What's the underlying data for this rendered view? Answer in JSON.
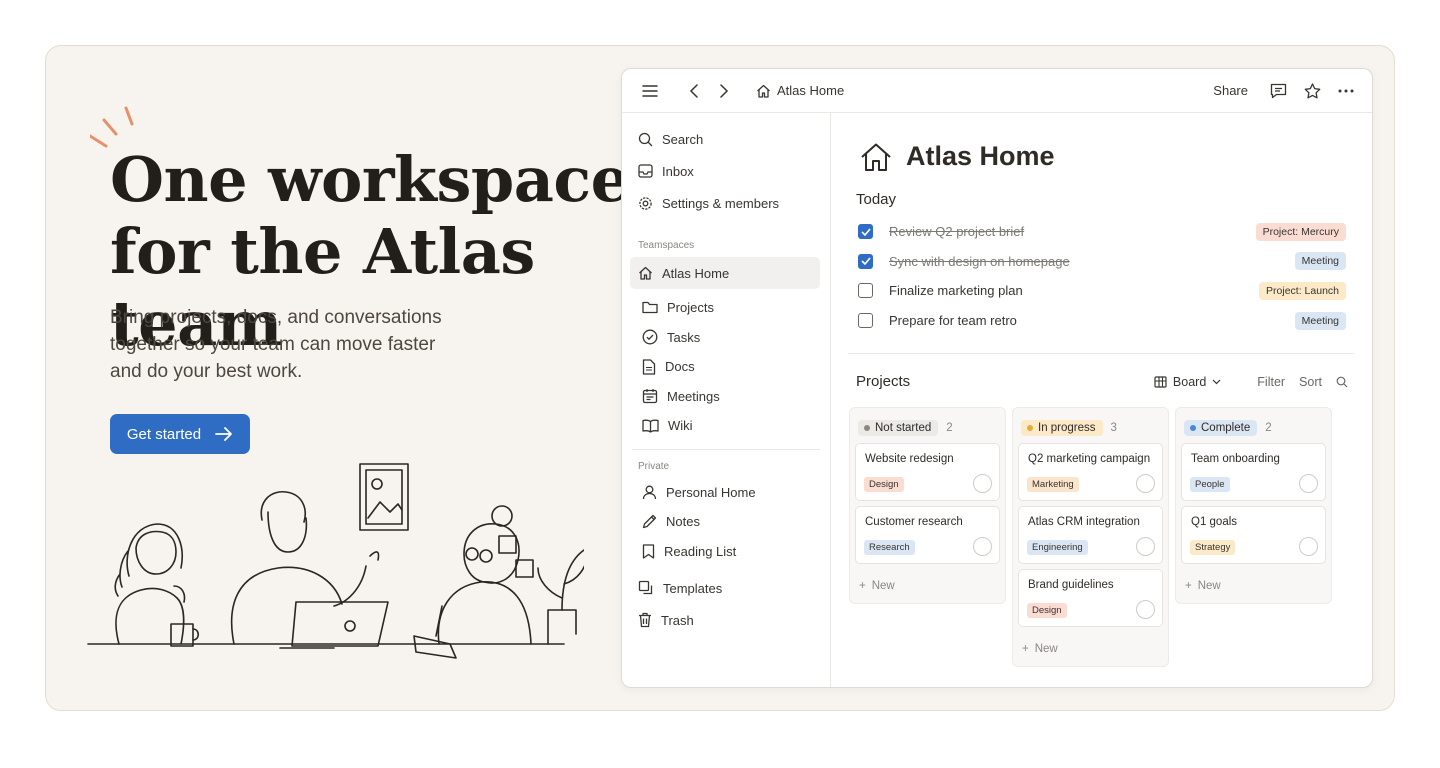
{
  "hero": {
    "title": "One workspace for the Atlas team",
    "subtitle": "Bring projects, docs, and conversations together so your team can move faster and do your best work.",
    "cta_label": "Get started"
  },
  "colors": {
    "accent": "#2f6dc4",
    "hero_bg": "#f7f4ef",
    "spark": "#e8906a"
  },
  "topbar": {
    "breadcrumb": "Atlas Home",
    "share_label": "Share"
  },
  "sidebar": {
    "top_items": [
      {
        "label": "Search",
        "icon": "search-icon"
      },
      {
        "label": "Inbox",
        "icon": "inbox-icon"
      },
      {
        "label": "Settings & members",
        "icon": "gear-icon"
      }
    ],
    "teamspaces_label": "Teamspaces",
    "teamspace_active": "Atlas Home",
    "teamspace_items": [
      {
        "label": "Projects",
        "icon": "folder-icon"
      },
      {
        "label": "Tasks",
        "icon": "check-circle-icon"
      },
      {
        "label": "Docs",
        "icon": "doc-icon"
      },
      {
        "label": "Meetings",
        "icon": "calendar-icon"
      },
      {
        "label": "Wiki",
        "icon": "book-icon"
      }
    ],
    "private_label": "Private",
    "private_items": [
      {
        "label": "Personal Home",
        "icon": "person-icon"
      },
      {
        "label": "Notes",
        "icon": "pencil-icon"
      },
      {
        "label": "Reading List",
        "icon": "bookmark-icon"
      }
    ],
    "bottom_items": [
      {
        "label": "Templates",
        "icon": "templates-icon"
      },
      {
        "label": "Trash",
        "icon": "trash-icon"
      }
    ]
  },
  "main": {
    "page_title": "Atlas Home",
    "today_heading": "Today",
    "tasks": [
      {
        "text": "Review Q2 project brief",
        "done": true,
        "tag": "Project: Mercury",
        "tag_color": "#fbdcd3"
      },
      {
        "text": "Sync with design on homepage",
        "done": true,
        "tag": "Meeting",
        "tag_color": "#dbe6f5"
      },
      {
        "text": "Finalize marketing plan",
        "done": false,
        "tag": "Project: Launch",
        "tag_color": "#fbe9c8"
      },
      {
        "text": "Prepare for team retro",
        "done": false,
        "tag": "Meeting",
        "tag_color": "#dbe6f5"
      }
    ],
    "projects_heading": "Projects",
    "view_label": "Board",
    "filter_label": "Filter",
    "sort_label": "Sort",
    "new_label": "New",
    "columns": [
      {
        "status": "Not started",
        "count": "2",
        "status_bg": "#ebeae7",
        "dot": "#8a8782",
        "cards": [
          {
            "title": "Website redesign",
            "tag": "Design",
            "tag_bg": "#fbdcd3"
          },
          {
            "title": "Customer research",
            "tag": "Research",
            "tag_bg": "#dbe6f5"
          }
        ]
      },
      {
        "status": "In progress",
        "count": "3",
        "status_bg": "#fbe9c8",
        "dot": "#e8a83a",
        "cards": [
          {
            "title": "Q2 marketing campaign",
            "tag": "Marketing",
            "tag_bg": "#fbe4cc"
          },
          {
            "title": "Atlas CRM integration",
            "tag": "Engineering",
            "tag_bg": "#dbe6f5"
          },
          {
            "title": "Brand guidelines",
            "tag": "Design",
            "tag_bg": "#fbdcd3"
          }
        ]
      },
      {
        "status": "Complete",
        "count": "2",
        "status_bg": "#dbe6f5",
        "dot": "#4a86d6",
        "cards": [
          {
            "title": "Team onboarding",
            "tag": "People",
            "tag_bg": "#dbe6f5"
          },
          {
            "title": "Q1 goals",
            "tag": "Strategy",
            "tag_bg": "#fbe9c8"
          }
        ]
      }
    ]
  }
}
